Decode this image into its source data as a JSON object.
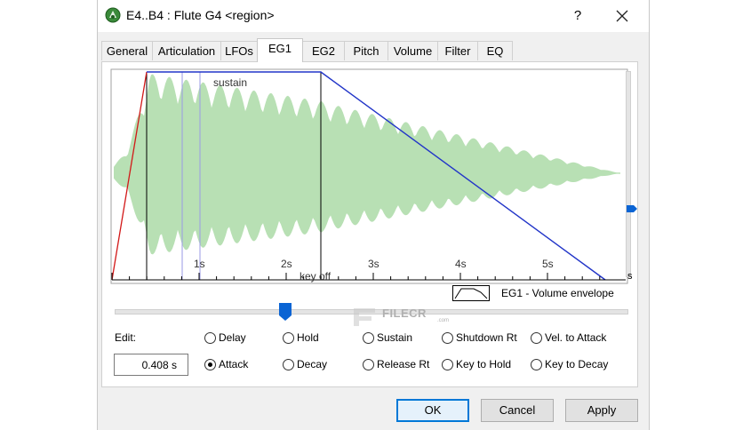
{
  "window": {
    "title": "E4..B4 : Flute G4 <region>",
    "help_label": "?"
  },
  "tabs": [
    {
      "label": "General"
    },
    {
      "label": "Articulation"
    },
    {
      "label": "LFOs"
    },
    {
      "label": "EG1"
    },
    {
      "label": "EG2"
    },
    {
      "label": "Pitch"
    },
    {
      "label": "Volume"
    },
    {
      "label": "Filter"
    },
    {
      "label": "EQ"
    }
  ],
  "active_tab": "EG1",
  "graph": {
    "sustain_label": "sustain",
    "keyoff_label": "key off",
    "time_ticks": [
      "1s",
      "2s",
      "3s",
      "4s",
      "5s"
    ],
    "unit": "s",
    "legend": "EG1 - Volume envelope",
    "colors": {
      "waveform": "#b8e0b4",
      "envelope": "#2235c8",
      "attack": "#d21818",
      "markers": "#000000",
      "cursor": "#9a9ae6"
    }
  },
  "edit": {
    "label": "Edit:",
    "value": "0.408 s",
    "slider_position": 0.34
  },
  "radios": [
    {
      "label": "Delay",
      "checked": false
    },
    {
      "label": "Hold",
      "checked": false
    },
    {
      "label": "Sustain",
      "checked": false
    },
    {
      "label": "Shutdown Rt",
      "checked": false
    },
    {
      "label": "Vel. to Attack",
      "checked": false
    },
    {
      "label": "Attack",
      "checked": true
    },
    {
      "label": "Decay",
      "checked": false
    },
    {
      "label": "Release Rt",
      "checked": false
    },
    {
      "label": "Key to Hold",
      "checked": false
    },
    {
      "label": "Key to Decay",
      "checked": false
    }
  ],
  "buttons": {
    "ok": "OK",
    "cancel": "Cancel",
    "apply": "Apply"
  },
  "watermark": {
    "text": "FILECR",
    "sub": ".com"
  }
}
